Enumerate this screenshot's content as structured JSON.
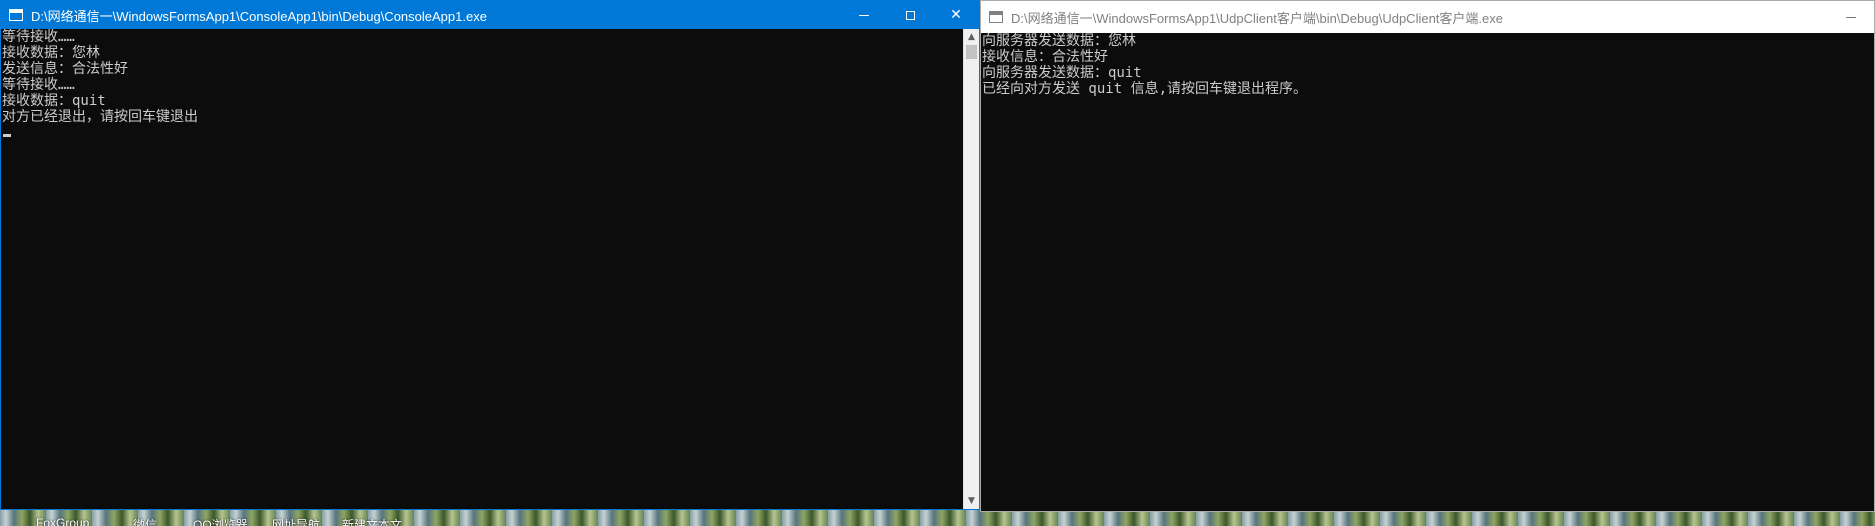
{
  "desktop": {
    "icons": [
      {
        "label": "FoxGroup",
        "icon": "app-icon"
      },
      {
        "label": "微信",
        "icon": "wechat-icon"
      },
      {
        "label": "QQ浏览器",
        "icon": "browser-icon"
      },
      {
        "label": "网址导航",
        "icon": "link-icon"
      },
      {
        "label": "新建文本文",
        "icon": "text-file-icon"
      }
    ]
  },
  "window_server": {
    "title": "D:\\网络通信一\\WindowsFormsApp1\\ConsoleApp1\\bin\\Debug\\ConsoleApp1.exe",
    "active": true,
    "accent": "#0078d7",
    "lines": [
      "等待接收……",
      "接收数据：您林",
      "发送信息：合法性好",
      "等待接收……",
      "接收数据：quit",
      "对方已经退出，请按回车键退出"
    ]
  },
  "window_client": {
    "title": "D:\\网络通信一\\WindowsFormsApp1\\UdpClient客户端\\bin\\Debug\\UdpClient客户端.exe",
    "active": false,
    "lines": [
      "向服务器发送数据：您林",
      "接收信息：合法性好",
      "向服务器发送数据：quit",
      "已经向对方发送 quit 信息,请按回车键退出程序。"
    ]
  },
  "controls": {
    "minimize": "—",
    "maximize": "☐",
    "close": "✕"
  }
}
